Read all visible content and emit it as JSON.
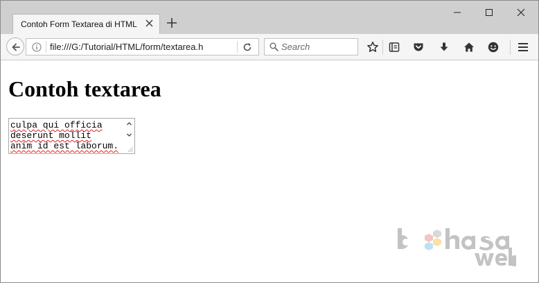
{
  "window": {
    "tab_title": "Contoh Form Textarea di HTML",
    "controls": {
      "minimize": "minimize",
      "maximize": "maximize",
      "close": "close"
    }
  },
  "navbar": {
    "url": "file:///G:/Tutorial/HTML/form/textarea.h",
    "search_placeholder": "Search",
    "icons": [
      "back-arrow-icon",
      "info-icon",
      "reload-icon",
      "search-icon",
      "bookmark-star-icon",
      "reader-list-icon",
      "pocket-icon",
      "download-icon",
      "home-icon",
      "smiley-icon",
      "menu-icon"
    ]
  },
  "page": {
    "heading": "Contoh textarea",
    "textarea_value": "culpa qui officia\ndeserunt mollit\nanim id est laborum."
  },
  "colors": {
    "tabstrip": "#cfcfcf",
    "toolbar": "#f5f5f5",
    "spellcheck": "#e02020"
  }
}
